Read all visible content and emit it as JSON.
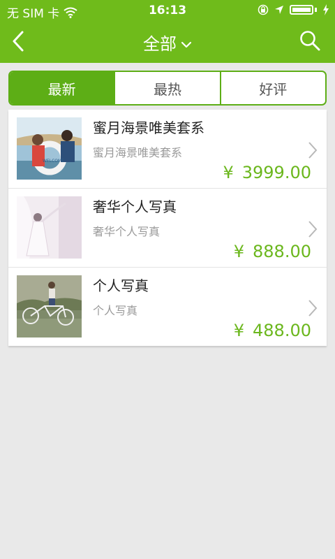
{
  "status": {
    "carrier": "无 SIM 卡",
    "time": "16:13"
  },
  "nav": {
    "title": "全部",
    "back_icon": "chevron-left-icon",
    "search_icon": "search-icon"
  },
  "tabs": [
    {
      "label": "最新",
      "active": true
    },
    {
      "label": "最热",
      "active": false
    },
    {
      "label": "好评",
      "active": false
    }
  ],
  "items": [
    {
      "title": "蜜月海景唯美套系",
      "subtitle": "蜜月海景唯美套系",
      "currency": "¥",
      "price": "3999.00",
      "image": "couple-photo"
    },
    {
      "title": "奢华个人写真",
      "subtitle": "奢华个人写真",
      "currency": "¥",
      "price": "888.00",
      "image": "bride-photo"
    },
    {
      "title": "个人写真",
      "subtitle": "个人写真",
      "currency": "¥",
      "price": "488.00",
      "image": "bicycle-photo"
    }
  ],
  "colors": {
    "brand": "#6fbb1b",
    "tab_active": "#5dae16",
    "price": "#6bb71d"
  }
}
